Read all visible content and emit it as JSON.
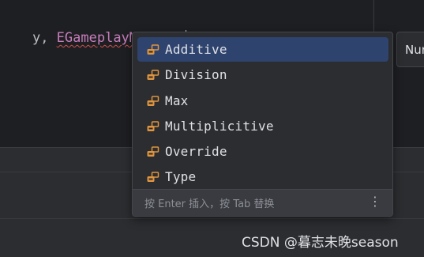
{
  "editor": {
    "code_prefix": "y, ",
    "code_type": "EGameplayModOp",
    "code_scope": "::",
    "code_paren": ")"
  },
  "hint_box": {
    "text": "Nur"
  },
  "completion": {
    "items": [
      {
        "label": "Additive",
        "icon": "enum-member-icon",
        "selected": true
      },
      {
        "label": "Division",
        "icon": "enum-member-icon",
        "selected": false
      },
      {
        "label": "Max",
        "icon": "enum-member-icon",
        "selected": false
      },
      {
        "label": "Multiplicitive",
        "icon": "enum-member-icon",
        "selected": false
      },
      {
        "label": "Override",
        "icon": "enum-member-icon",
        "selected": false
      },
      {
        "label": "Type",
        "icon": "enum-member-icon",
        "selected": false
      }
    ],
    "footer_hint": "按 Enter 插入，按 Tab 替换",
    "menu_glyph": "⋮"
  },
  "watermark": {
    "text": "CSDN @暮志未晚season"
  },
  "colors": {
    "selected_row": "#2e436e",
    "icon_orange": "#e0953f",
    "type_purple": "#c77dbb"
  }
}
